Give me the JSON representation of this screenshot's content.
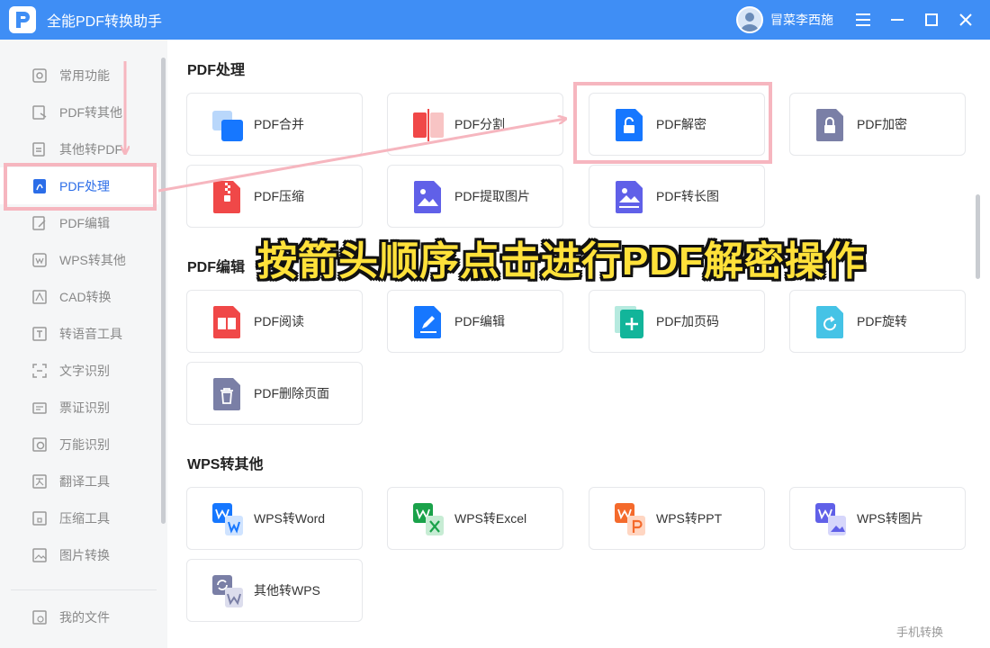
{
  "app": {
    "title": "全能PDF转换助手"
  },
  "user": {
    "name": "冒菜李西施"
  },
  "sidebar": {
    "items": [
      {
        "label": "常用功能",
        "icon": "home-icon"
      },
      {
        "label": "PDF转其他",
        "icon": "pdf-export-icon"
      },
      {
        "label": "其他转PDF",
        "icon": "pdf-import-icon"
      },
      {
        "label": "PDF处理",
        "icon": "pdf-process-icon",
        "active": true
      },
      {
        "label": "PDF编辑",
        "icon": "pdf-edit-icon"
      },
      {
        "label": "WPS转其他",
        "icon": "wps-export-icon"
      },
      {
        "label": "CAD转换",
        "icon": "cad-icon"
      },
      {
        "label": "转语音工具",
        "icon": "speech-icon"
      },
      {
        "label": "文字识别",
        "icon": "ocr-icon"
      },
      {
        "label": "票证识别",
        "icon": "ticket-icon"
      },
      {
        "label": "万能识别",
        "icon": "recognize-icon"
      },
      {
        "label": "翻译工具",
        "icon": "translate-icon"
      },
      {
        "label": "压缩工具",
        "icon": "compress-icon"
      },
      {
        "label": "图片转换",
        "icon": "image-convert-icon"
      }
    ],
    "my_files": "我的文件"
  },
  "sections": [
    {
      "title": "PDF处理",
      "cards": [
        {
          "label": "PDF合并",
          "icon": "merge-icon"
        },
        {
          "label": "PDF分割",
          "icon": "split-icon"
        },
        {
          "label": "PDF解密",
          "icon": "unlock-icon"
        },
        {
          "label": "PDF加密",
          "icon": "lock-icon"
        },
        {
          "label": "PDF压缩",
          "icon": "zip-icon"
        },
        {
          "label": "PDF提取图片",
          "icon": "extract-image-icon"
        },
        {
          "label": "PDF转长图",
          "icon": "long-image-icon"
        }
      ]
    },
    {
      "title": "PDF编辑",
      "cards": [
        {
          "label": "PDF阅读",
          "icon": "read-icon"
        },
        {
          "label": "PDF编辑",
          "icon": "edit-icon"
        },
        {
          "label": "PDF加页码",
          "icon": "page-number-icon"
        },
        {
          "label": "PDF旋转",
          "icon": "rotate-icon"
        },
        {
          "label": "PDF删除页面",
          "icon": "delete-page-icon"
        }
      ]
    },
    {
      "title": "WPS转其他",
      "cards": [
        {
          "label": "WPS转Word",
          "icon": "wps-word-icon"
        },
        {
          "label": "WPS转Excel",
          "icon": "wps-excel-icon"
        },
        {
          "label": "WPS转PPT",
          "icon": "wps-ppt-icon"
        },
        {
          "label": "WPS转图片",
          "icon": "wps-image-icon"
        },
        {
          "label": "其他转WPS",
          "icon": "to-wps-icon"
        }
      ]
    }
  ],
  "footer": {
    "mobile": "手机转换"
  },
  "annotation": {
    "instruction": "按箭头顺序点击进行PDF解密操作"
  },
  "colors": {
    "titlebar": "#3f8ef5",
    "active": "#2b6de8",
    "highlight": "#f6b6bf",
    "overlay_text": "#ffe13a"
  }
}
